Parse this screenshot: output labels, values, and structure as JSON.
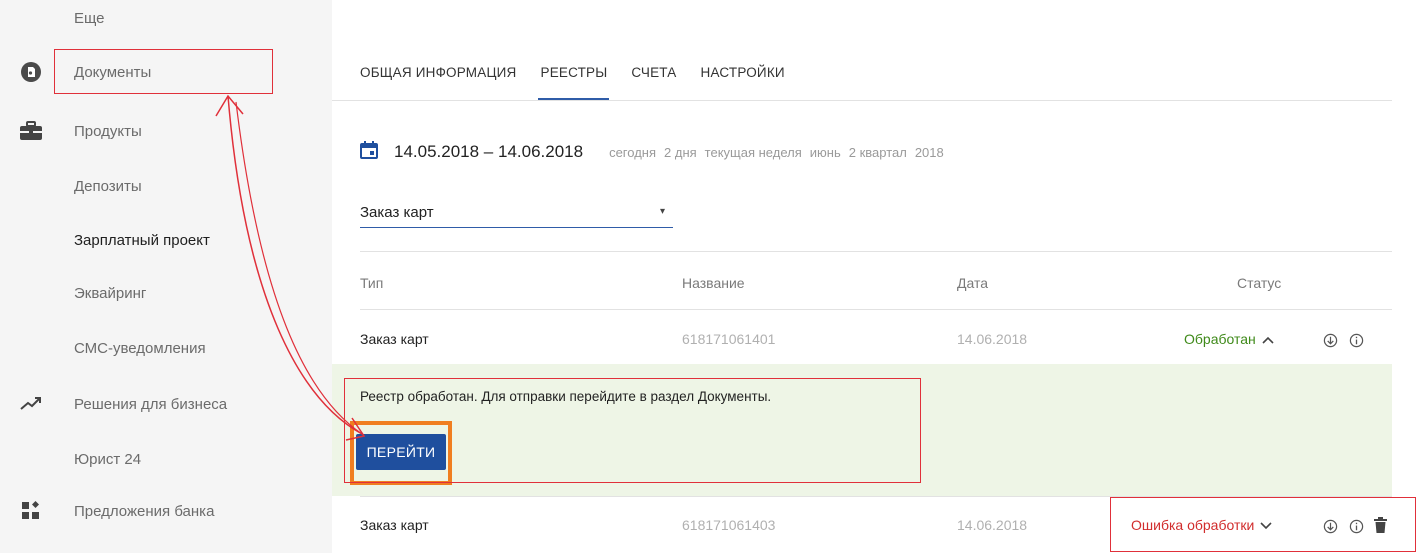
{
  "sidebar": {
    "items": [
      {
        "label": "Еще",
        "icon": "",
        "active": false
      },
      {
        "label": "Документы",
        "icon": "document-badge-icon",
        "active": false
      },
      {
        "label": "Продукты",
        "icon": "briefcase-icon",
        "active": false
      },
      {
        "label": "Депозиты",
        "icon": "",
        "active": false
      },
      {
        "label": "Зарплатный проект",
        "icon": "",
        "active": true
      },
      {
        "label": "Эквайринг",
        "icon": "",
        "active": false
      },
      {
        "label": "СМС-уведомления",
        "icon": "",
        "active": false
      },
      {
        "label": "Решения для бизнеса",
        "icon": "trending-up-icon",
        "active": false
      },
      {
        "label": "Юрист 24",
        "icon": "",
        "active": false
      },
      {
        "label": "Предложения банка",
        "icon": "offers-grid-icon",
        "active": false
      }
    ]
  },
  "tabs": [
    {
      "label": "ОБЩАЯ ИНФОРМАЦИЯ",
      "active": false
    },
    {
      "label": "РЕЕСТРЫ",
      "active": true
    },
    {
      "label": "СЧЕТА",
      "active": false
    },
    {
      "label": "НАСТРОЙКИ",
      "active": false
    }
  ],
  "date_filter": {
    "icon": "calendar-icon",
    "range": "14.05.2018 – 14.06.2018",
    "periods": [
      "сегодня",
      "2 дня",
      "текущая неделя",
      "июнь",
      "2 квартал",
      "2018"
    ]
  },
  "register_type_select": {
    "value": "Заказ карт",
    "arrow": "▾"
  },
  "table": {
    "headers": {
      "type": "Тип",
      "name": "Название",
      "date": "Дата",
      "status": "Статус"
    },
    "rows": [
      {
        "type": "Заказ карт",
        "name": "618171061401",
        "date": "14.06.2018",
        "status": "Обработан",
        "chevron": "^",
        "status_color": "#3f8a1a"
      },
      {
        "type": "Заказ карт",
        "name": "618171061403",
        "date": "14.06.2018",
        "status": "Ошибка обработки",
        "chevron": "⌄",
        "status_color": "#d12d2d"
      }
    ]
  },
  "expanded_row": {
    "message": "Реестр обработан. Для отправки перейдите в раздел Документы.",
    "button_label": "ПЕРЕЙТИ"
  },
  "colors": {
    "accent": "#2f5ca8",
    "button": "#1f4f9e",
    "success": "#3f8a1a",
    "error": "#d12d2d",
    "panel_bg": "#eef5e6",
    "annotation_red": "#e0303a",
    "annotation_orange": "#f07e20"
  }
}
